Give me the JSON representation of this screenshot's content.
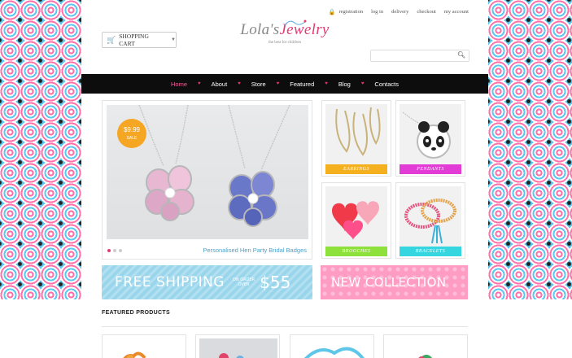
{
  "header": {
    "top_links": [
      "registration",
      "log in",
      "delivery",
      "checkout",
      "my account"
    ],
    "cart_label": "SHOPPING CART",
    "logo_main": "Lola's",
    "logo_accent": "Jewelry",
    "tagline": "the best for children",
    "search_placeholder": ""
  },
  "nav": {
    "items": [
      "Home",
      "About",
      "Store",
      "Featured",
      "Blog",
      "Contacts"
    ],
    "active": "Home"
  },
  "slider": {
    "price": "$9.99",
    "badge_text": "SALE",
    "caption": "Personalised Hen Party Bridal Badges",
    "dots": 3,
    "active_dot": 1
  },
  "categories": [
    {
      "label": "EARRINGS",
      "color": "#f5b020"
    },
    {
      "label": "PENDANTS",
      "color": "#e23bd6"
    },
    {
      "label": "BROOCHES",
      "color": "#8ee03a"
    },
    {
      "label": "BRACELETS",
      "color": "#35d6e0"
    }
  ],
  "banners": {
    "shipping_big": "FREE SHIPPING",
    "shipping_small_1": "ON ORDER",
    "shipping_small_2": "OVER",
    "shipping_amount": "$55",
    "new_collection": "NEW COLLECTION"
  },
  "featured": {
    "title": "FEATURED PRODUCTS"
  },
  "colors": {
    "accent": "#e23b72",
    "nav_bg": "#0d0d0d",
    "shipping_banner": "#99d6ec",
    "collection_banner": "#ff9cc4"
  }
}
